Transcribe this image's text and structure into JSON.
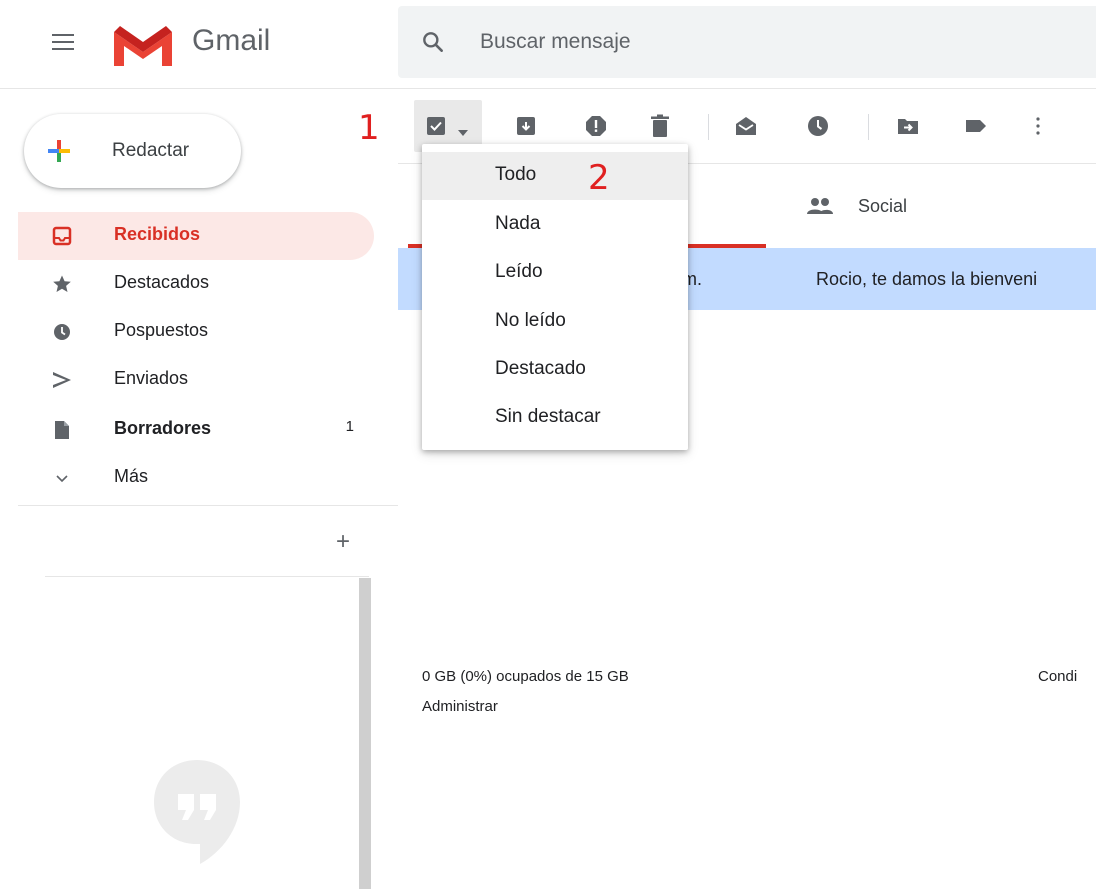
{
  "header": {
    "brand": "Gmail",
    "search_placeholder": "Buscar mensaje"
  },
  "compose": {
    "label": "Redactar"
  },
  "annotations": {
    "step1": "1",
    "step2": "2"
  },
  "sidebar": {
    "items": [
      {
        "label": "Recibidos",
        "icon": "inbox-icon",
        "active": true
      },
      {
        "label": "Destacados",
        "icon": "star-icon"
      },
      {
        "label": "Pospuestos",
        "icon": "clock-icon"
      },
      {
        "label": "Enviados",
        "icon": "send-icon"
      },
      {
        "label": "Borradores",
        "icon": "draft-icon",
        "count": "1"
      },
      {
        "label": "Más",
        "icon": "chevron-down-icon"
      }
    ]
  },
  "toolbar": {
    "icons": [
      "select-checkbox-icon",
      "archive-icon",
      "report-spam-icon",
      "delete-icon",
      "mark-read-icon",
      "snooze-icon",
      "move-to-icon",
      "label-icon",
      "more-vert-icon"
    ]
  },
  "select_menu": {
    "items": [
      "Todo",
      "Nada",
      "Leído",
      "No leído",
      "Destacado",
      "Sin destacar"
    ]
  },
  "tabs": {
    "social": "Social"
  },
  "mail": {
    "sender_fragment": "m.",
    "subject": "Rocio, te damos la bienveni"
  },
  "footer": {
    "storage": "0 GB (0%) ocupados de 15 GB",
    "manage": "Administrar",
    "terms": "Condi"
  },
  "colors": {
    "accent_red": "#d93025",
    "selected_row": "#c2dbff",
    "active_nav_bg": "#fce8e6",
    "annotation": "#e02020"
  }
}
